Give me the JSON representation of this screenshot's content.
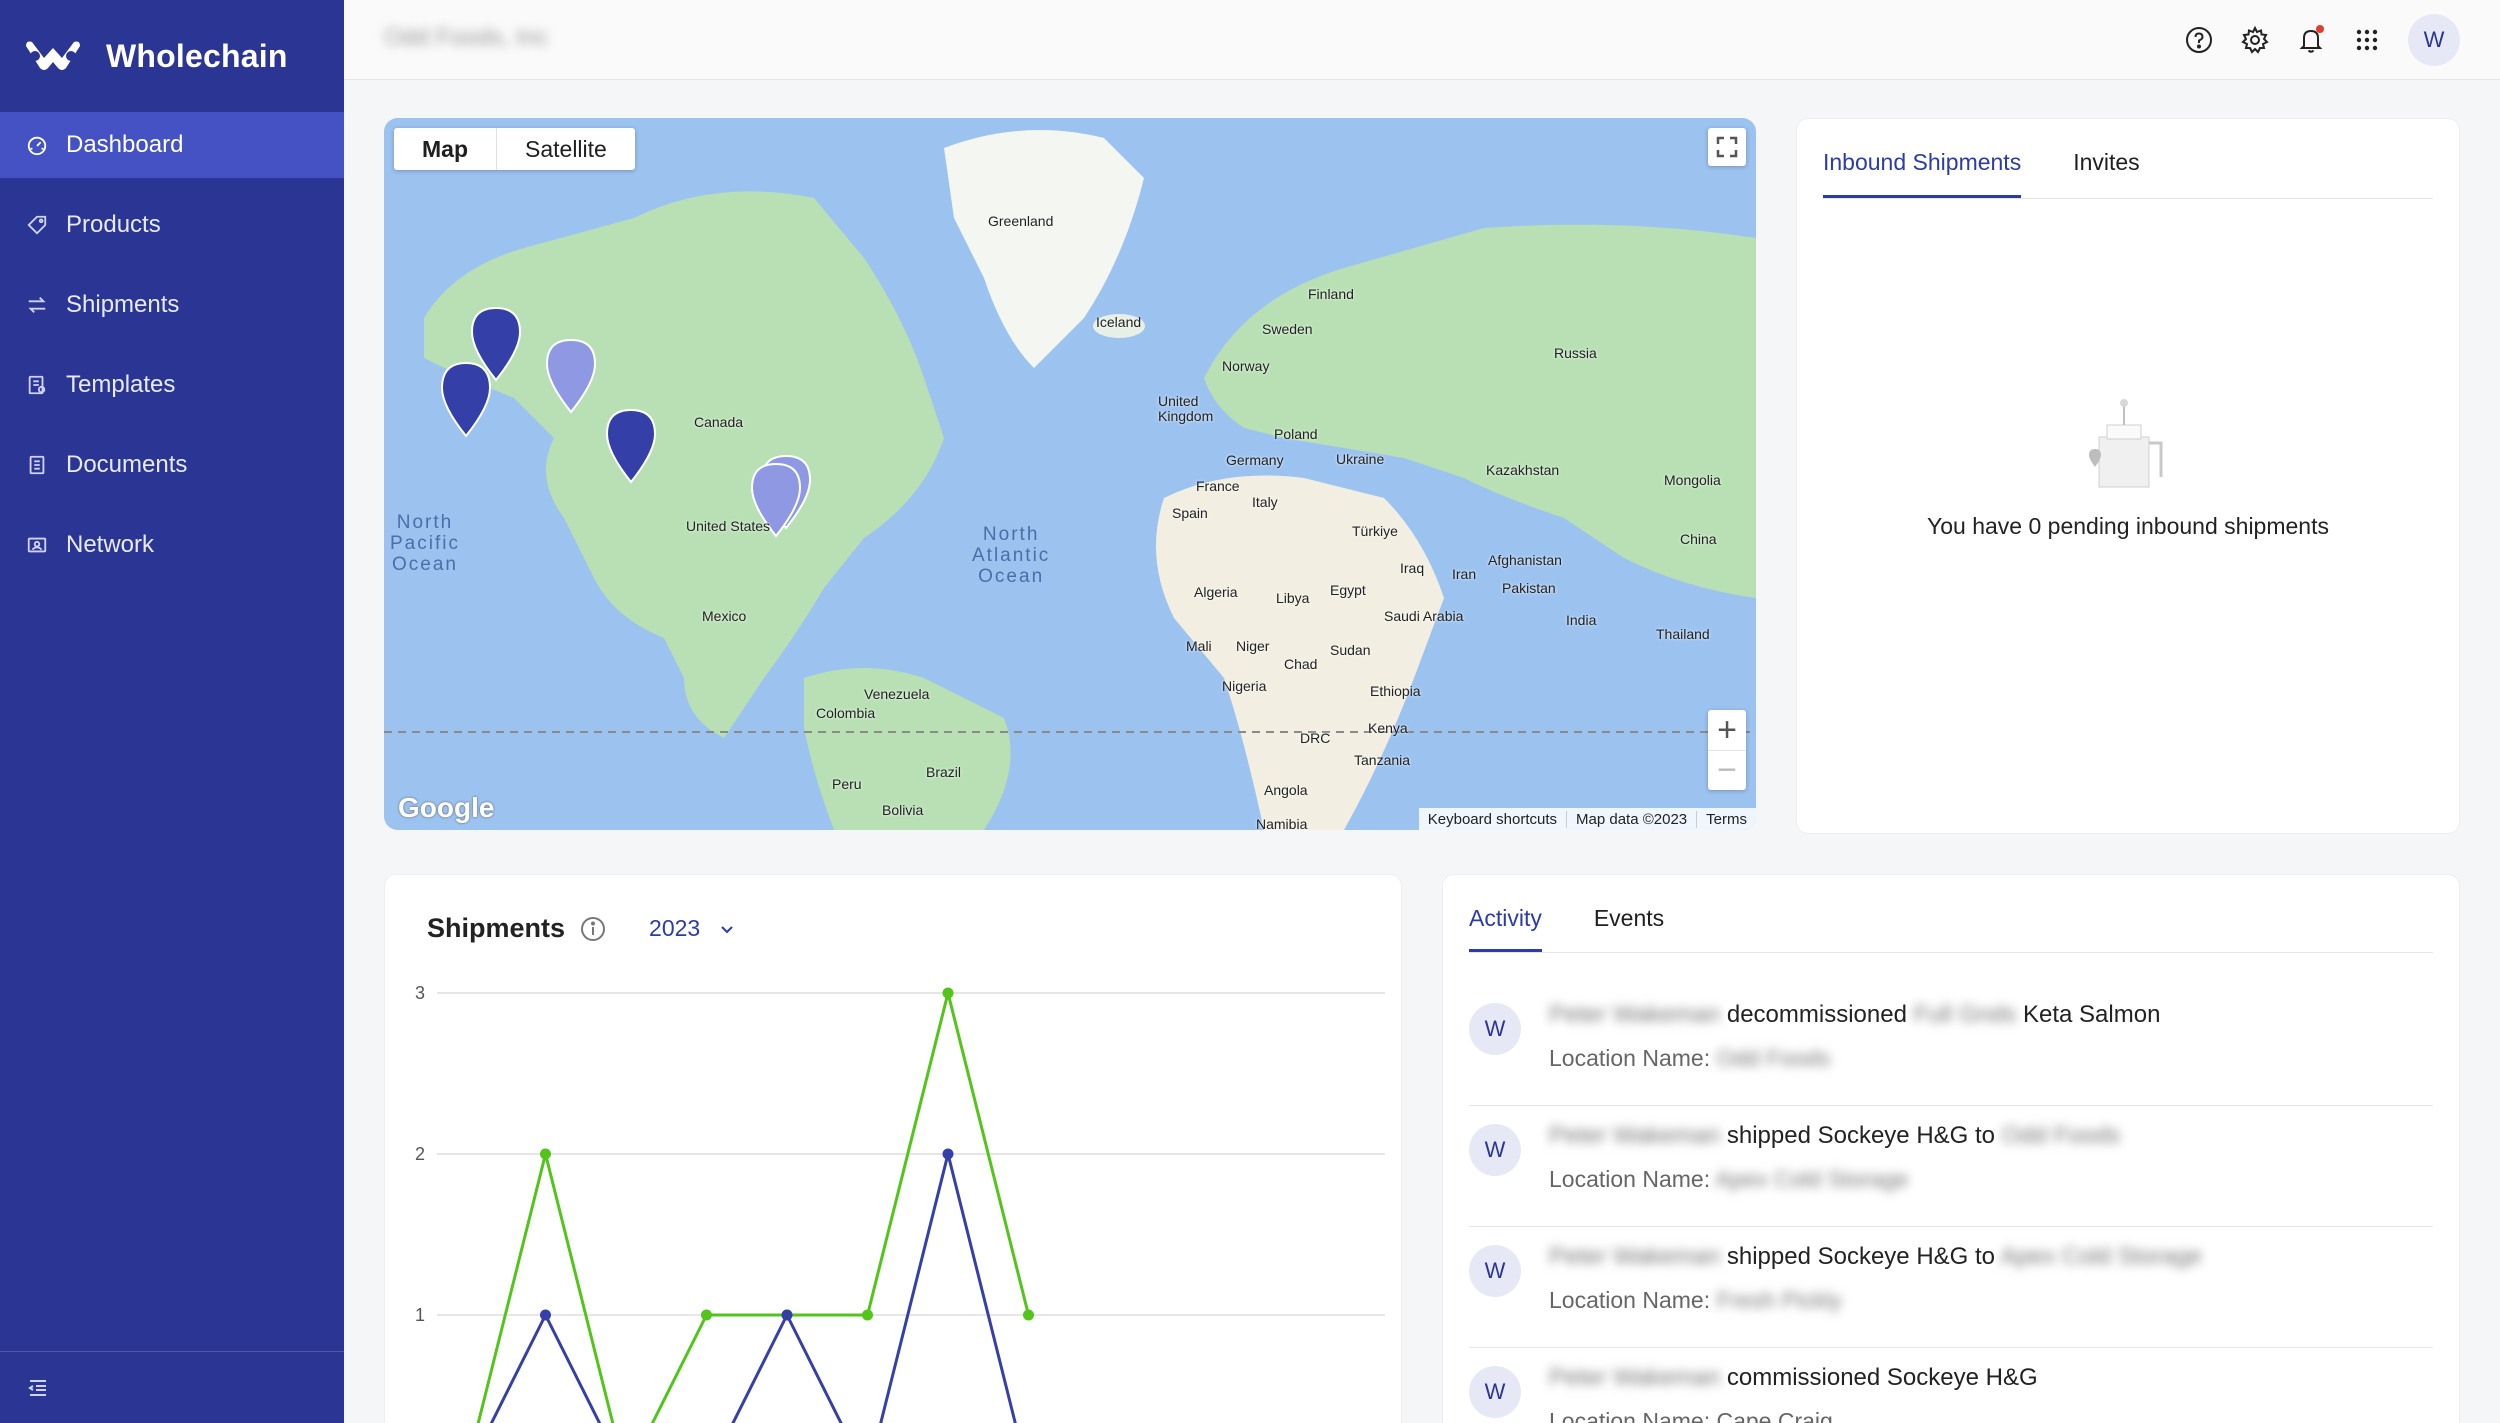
{
  "brand": {
    "name": "Wholechain"
  },
  "sidebar": {
    "items": [
      {
        "label": "Dashboard",
        "icon": "dashboard-icon",
        "active": true
      },
      {
        "label": "Products",
        "icon": "tag-icon"
      },
      {
        "label": "Shipments",
        "icon": "transfer-icon"
      },
      {
        "label": "Templates",
        "icon": "template-icon"
      },
      {
        "label": "Documents",
        "icon": "document-icon"
      },
      {
        "label": "Network",
        "icon": "network-icon"
      }
    ],
    "collapse_icon": "collapse-menu-icon"
  },
  "topbar": {
    "org_name": "Odd Foods, Inc",
    "icons": [
      "help-icon",
      "settings-icon",
      "bell-icon",
      "apps-grid-icon"
    ],
    "avatar_initial": "W",
    "accent": "#2b3594",
    "notification_color": "#e53935"
  },
  "map": {
    "toggle": {
      "map": "Map",
      "satellite": "Satellite"
    },
    "attribution": {
      "shortcuts": "Keyboard shortcuts",
      "data": "Map data ©2023",
      "terms": "Terms"
    },
    "google": "Google",
    "labels": {
      "greenland": "Greenland",
      "iceland": "Iceland",
      "finland": "Finland",
      "sweden": "Sweden",
      "norway": "Norway",
      "russia": "Russia",
      "uk": "United\nKingdom",
      "poland": "Poland",
      "germany": "Germany",
      "ukraine": "Ukraine",
      "france": "France",
      "spain": "Spain",
      "italy": "Italy",
      "kazakhstan": "Kazakhstan",
      "mongolia": "Mongolia",
      "turkiye": "Türkiye",
      "china": "China",
      "afghanistan": "Afghanistan",
      "iraq": "Iraq",
      "iran": "Iran",
      "pakistan": "Pakistan",
      "india": "India",
      "thailand": "Thailand",
      "algeria": "Algeria",
      "libya": "Libya",
      "egypt": "Egypt",
      "saudi": "Saudi Arabia",
      "mali": "Mali",
      "niger": "Niger",
      "chad": "Chad",
      "sudan": "Sudan",
      "nigeria": "Nigeria",
      "ethiopia": "Ethiopia",
      "kenya": "Kenya",
      "drc": "DRC",
      "tanzania": "Tanzania",
      "angola": "Angola",
      "namibia": "Namibia",
      "canada": "Canada",
      "us": "United States",
      "mexico": "Mexico",
      "venezuela": "Venezuela",
      "colombia": "Colombia",
      "brazil": "Brazil",
      "peru": "Peru",
      "bolivia": "Bolivia",
      "north_pacific": "North\nPacific\nOcean",
      "north_atlantic": "North\nAtlantic\nOcean"
    },
    "colors": {
      "water": "#9cc2f0",
      "land": "#b8e0b4",
      "pin_dark": "#3440a8",
      "pin_light": "#8f98e2"
    }
  },
  "inbound": {
    "tabs": [
      {
        "label": "Inbound Shipments",
        "active": true
      },
      {
        "label": "Invites"
      }
    ],
    "empty_text": "You have 0 pending inbound shipments"
  },
  "shipments_chart": {
    "title": "Shipments",
    "year": "2023",
    "info_icon": "info-icon",
    "chevron_icon": "chevron-down-icon"
  },
  "chart_data": {
    "type": "line",
    "ylim": [
      0,
      3
    ],
    "yticks": [
      1,
      2,
      3
    ],
    "x": [
      1,
      2,
      3,
      4,
      5,
      6,
      7,
      8
    ],
    "series": [
      {
        "color": "#52c41a",
        "values": [
          0,
          2,
          0,
          1,
          1,
          1,
          3,
          1
        ]
      },
      {
        "color": "#3440a8",
        "values": [
          0,
          1,
          0,
          0,
          1,
          0,
          2,
          0
        ]
      }
    ],
    "grid": true,
    "legend": "none"
  },
  "activity": {
    "tabs": [
      {
        "label": "Activity",
        "active": true
      },
      {
        "label": "Events"
      }
    ],
    "location_label": "Location Name:",
    "items": [
      {
        "avatar": "W",
        "user": "Peter Wakeman",
        "action": "decommissioned",
        "object_blur": "Full Gnds",
        "object": "Keta Salmon",
        "location": "Odd Foods"
      },
      {
        "avatar": "W",
        "user": "Peter Wakeman",
        "action": "shipped Sockeye H&G to",
        "object_blur": "Odd Foods",
        "object": "",
        "location": "Apex Cold Storage"
      },
      {
        "avatar": "W",
        "user": "Peter Wakeman",
        "action": "shipped Sockeye H&G to",
        "object_blur": "Apex Cold Storage",
        "object": "",
        "location": "Fresh Pickly"
      },
      {
        "avatar": "W",
        "user": "Peter Wakeman",
        "action": "commissioned Sockeye H&G",
        "object_blur": "",
        "object": "",
        "location": "Cape Craig"
      }
    ]
  }
}
